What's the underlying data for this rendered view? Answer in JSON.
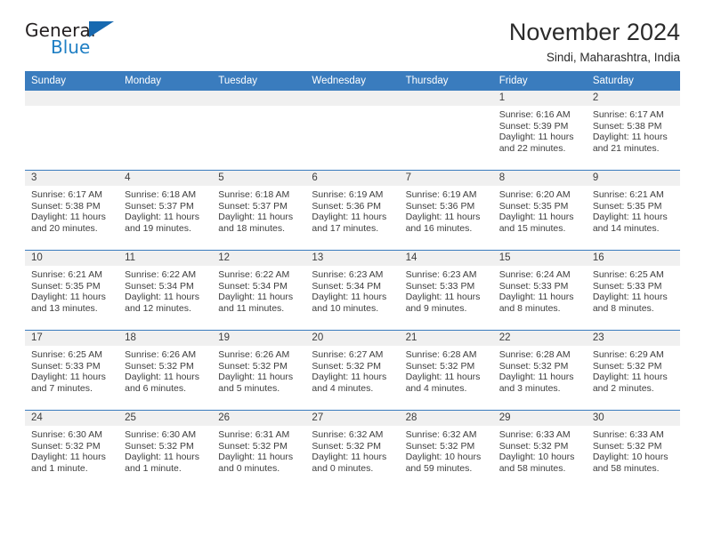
{
  "brand": {
    "name_top": "General",
    "name_bottom": "Blue",
    "flag_icon": "triangle-flag-icon",
    "accent_color": "#1769b0"
  },
  "header": {
    "title": "November 2024",
    "subtitle": "Sindi, Maharashtra, India"
  },
  "theme": {
    "header_bg": "#3a7cbe",
    "header_text": "#ffffff",
    "daynum_band_bg": "#f0f0f0",
    "row_border": "#3a7cbe",
    "body_text": "#3d3d3d"
  },
  "weekday_headers": [
    "Sunday",
    "Monday",
    "Tuesday",
    "Wednesday",
    "Thursday",
    "Friday",
    "Saturday"
  ],
  "weeks": [
    [
      {
        "day": "",
        "empty": true
      },
      {
        "day": "",
        "empty": true
      },
      {
        "day": "",
        "empty": true
      },
      {
        "day": "",
        "empty": true
      },
      {
        "day": "",
        "empty": true
      },
      {
        "day": "1",
        "sunrise": "Sunrise: 6:16 AM",
        "sunset": "Sunset: 5:39 PM",
        "daylight": "Daylight: 11 hours and 22 minutes."
      },
      {
        "day": "2",
        "sunrise": "Sunrise: 6:17 AM",
        "sunset": "Sunset: 5:38 PM",
        "daylight": "Daylight: 11 hours and 21 minutes."
      }
    ],
    [
      {
        "day": "3",
        "sunrise": "Sunrise: 6:17 AM",
        "sunset": "Sunset: 5:38 PM",
        "daylight": "Daylight: 11 hours and 20 minutes."
      },
      {
        "day": "4",
        "sunrise": "Sunrise: 6:18 AM",
        "sunset": "Sunset: 5:37 PM",
        "daylight": "Daylight: 11 hours and 19 minutes."
      },
      {
        "day": "5",
        "sunrise": "Sunrise: 6:18 AM",
        "sunset": "Sunset: 5:37 PM",
        "daylight": "Daylight: 11 hours and 18 minutes."
      },
      {
        "day": "6",
        "sunrise": "Sunrise: 6:19 AM",
        "sunset": "Sunset: 5:36 PM",
        "daylight": "Daylight: 11 hours and 17 minutes."
      },
      {
        "day": "7",
        "sunrise": "Sunrise: 6:19 AM",
        "sunset": "Sunset: 5:36 PM",
        "daylight": "Daylight: 11 hours and 16 minutes."
      },
      {
        "day": "8",
        "sunrise": "Sunrise: 6:20 AM",
        "sunset": "Sunset: 5:35 PM",
        "daylight": "Daylight: 11 hours and 15 minutes."
      },
      {
        "day": "9",
        "sunrise": "Sunrise: 6:21 AM",
        "sunset": "Sunset: 5:35 PM",
        "daylight": "Daylight: 11 hours and 14 minutes."
      }
    ],
    [
      {
        "day": "10",
        "sunrise": "Sunrise: 6:21 AM",
        "sunset": "Sunset: 5:35 PM",
        "daylight": "Daylight: 11 hours and 13 minutes."
      },
      {
        "day": "11",
        "sunrise": "Sunrise: 6:22 AM",
        "sunset": "Sunset: 5:34 PM",
        "daylight": "Daylight: 11 hours and 12 minutes."
      },
      {
        "day": "12",
        "sunrise": "Sunrise: 6:22 AM",
        "sunset": "Sunset: 5:34 PM",
        "daylight": "Daylight: 11 hours and 11 minutes."
      },
      {
        "day": "13",
        "sunrise": "Sunrise: 6:23 AM",
        "sunset": "Sunset: 5:34 PM",
        "daylight": "Daylight: 11 hours and 10 minutes."
      },
      {
        "day": "14",
        "sunrise": "Sunrise: 6:23 AM",
        "sunset": "Sunset: 5:33 PM",
        "daylight": "Daylight: 11 hours and 9 minutes."
      },
      {
        "day": "15",
        "sunrise": "Sunrise: 6:24 AM",
        "sunset": "Sunset: 5:33 PM",
        "daylight": "Daylight: 11 hours and 8 minutes."
      },
      {
        "day": "16",
        "sunrise": "Sunrise: 6:25 AM",
        "sunset": "Sunset: 5:33 PM",
        "daylight": "Daylight: 11 hours and 8 minutes."
      }
    ],
    [
      {
        "day": "17",
        "sunrise": "Sunrise: 6:25 AM",
        "sunset": "Sunset: 5:33 PM",
        "daylight": "Daylight: 11 hours and 7 minutes."
      },
      {
        "day": "18",
        "sunrise": "Sunrise: 6:26 AM",
        "sunset": "Sunset: 5:32 PM",
        "daylight": "Daylight: 11 hours and 6 minutes."
      },
      {
        "day": "19",
        "sunrise": "Sunrise: 6:26 AM",
        "sunset": "Sunset: 5:32 PM",
        "daylight": "Daylight: 11 hours and 5 minutes."
      },
      {
        "day": "20",
        "sunrise": "Sunrise: 6:27 AM",
        "sunset": "Sunset: 5:32 PM",
        "daylight": "Daylight: 11 hours and 4 minutes."
      },
      {
        "day": "21",
        "sunrise": "Sunrise: 6:28 AM",
        "sunset": "Sunset: 5:32 PM",
        "daylight": "Daylight: 11 hours and 4 minutes."
      },
      {
        "day": "22",
        "sunrise": "Sunrise: 6:28 AM",
        "sunset": "Sunset: 5:32 PM",
        "daylight": "Daylight: 11 hours and 3 minutes."
      },
      {
        "day": "23",
        "sunrise": "Sunrise: 6:29 AM",
        "sunset": "Sunset: 5:32 PM",
        "daylight": "Daylight: 11 hours and 2 minutes."
      }
    ],
    [
      {
        "day": "24",
        "sunrise": "Sunrise: 6:30 AM",
        "sunset": "Sunset: 5:32 PM",
        "daylight": "Daylight: 11 hours and 1 minute."
      },
      {
        "day": "25",
        "sunrise": "Sunrise: 6:30 AM",
        "sunset": "Sunset: 5:32 PM",
        "daylight": "Daylight: 11 hours and 1 minute."
      },
      {
        "day": "26",
        "sunrise": "Sunrise: 6:31 AM",
        "sunset": "Sunset: 5:32 PM",
        "daylight": "Daylight: 11 hours and 0 minutes."
      },
      {
        "day": "27",
        "sunrise": "Sunrise: 6:32 AM",
        "sunset": "Sunset: 5:32 PM",
        "daylight": "Daylight: 11 hours and 0 minutes."
      },
      {
        "day": "28",
        "sunrise": "Sunrise: 6:32 AM",
        "sunset": "Sunset: 5:32 PM",
        "daylight": "Daylight: 10 hours and 59 minutes."
      },
      {
        "day": "29",
        "sunrise": "Sunrise: 6:33 AM",
        "sunset": "Sunset: 5:32 PM",
        "daylight": "Daylight: 10 hours and 58 minutes."
      },
      {
        "day": "30",
        "sunrise": "Sunrise: 6:33 AM",
        "sunset": "Sunset: 5:32 PM",
        "daylight": "Daylight: 10 hours and 58 minutes."
      }
    ]
  ]
}
